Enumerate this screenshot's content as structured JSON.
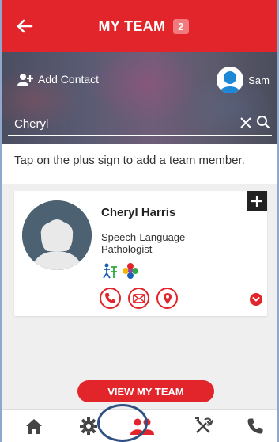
{
  "header": {
    "title": "MY TEAM",
    "count": "2"
  },
  "banner": {
    "add_contact_label": "Add Contact",
    "user_name": "Sam",
    "search": {
      "value": "Cheryl",
      "placeholder": ""
    }
  },
  "hint": "Tap on the plus sign to add a team member.",
  "contact": {
    "name": "Cheryl Harris",
    "role": "Speech-Language Pathologist"
  },
  "view_team_label": "VIEW MY TEAM",
  "tabs": [
    "home-icon",
    "settings-icon",
    "team-icon",
    "tools-icon",
    "phone-icon"
  ],
  "colors": {
    "accent": "#e2252b",
    "badge": "#f07a7d",
    "highlight": "#2e4f82"
  }
}
